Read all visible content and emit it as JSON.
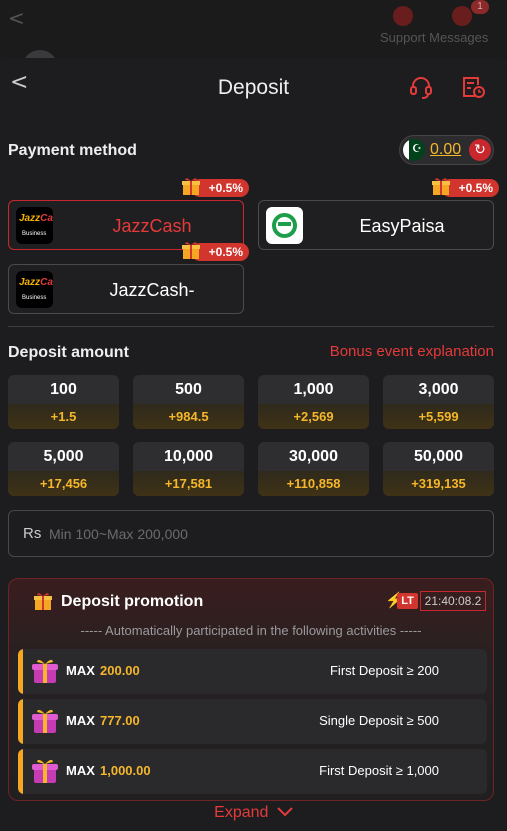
{
  "background": {
    "back_glyph": "<",
    "badge_count": "1",
    "support_messages": "Support Messages"
  },
  "header": {
    "back_glyph": "<",
    "title": "Deposit",
    "icons": [
      "headset-icon",
      "history-icon"
    ]
  },
  "payment": {
    "section_title": "Payment method",
    "balance": "0.00",
    "currency_flag": "pakistan-flag-icon",
    "methods": [
      {
        "label": "JazzCash",
        "bonus": "+0.5%",
        "logo": "jazzcash-logo",
        "active": true
      },
      {
        "label": "EasyPaisa",
        "bonus": "+0.5%",
        "logo": "easypaisa-logo",
        "active": false
      },
      {
        "label": "JazzCash-",
        "bonus": "+0.5%",
        "logo": "jazzcash-logo",
        "active": false
      }
    ],
    "logo_text": {
      "jazz": "Jazz",
      "cash": "Cash",
      "business": "Business"
    }
  },
  "deposit": {
    "section_title": "Deposit amount",
    "bonus_link": "Bonus event explanation",
    "amounts": [
      {
        "value": "100",
        "bonus": "+1.5"
      },
      {
        "value": "500",
        "bonus": "+984.5"
      },
      {
        "value": "1,000",
        "bonus": "+2,569"
      },
      {
        "value": "3,000",
        "bonus": "+5,599"
      },
      {
        "value": "5,000",
        "bonus": "+17,456"
      },
      {
        "value": "10,000",
        "bonus": "+17,581"
      },
      {
        "value": "30,000",
        "bonus": "+110,858"
      },
      {
        "value": "50,000",
        "bonus": "+319,135"
      }
    ],
    "currency_symbol": "Rs",
    "input_value": "",
    "input_placeholder": "Min 100~Max 200,000"
  },
  "promotion": {
    "title": "Deposit promotion",
    "lt_label": "LT",
    "countdown": "21:40:08.2",
    "subtitle": "----- Automatically participated in the following activities -----",
    "activities": [
      {
        "max_label": "MAX",
        "amount": "200.00",
        "condition": "First Deposit ≥ 200"
      },
      {
        "max_label": "MAX",
        "amount": "777.00",
        "condition": "Single Deposit ≥ 500"
      },
      {
        "max_label": "MAX",
        "amount": "1,000.00",
        "condition": "First Deposit ≥ 1,000"
      }
    ],
    "expand_label": "Expand"
  },
  "colors": {
    "accent_red": "#e33a3a",
    "gold": "#f5b62a",
    "background": "#1d1d1f"
  }
}
